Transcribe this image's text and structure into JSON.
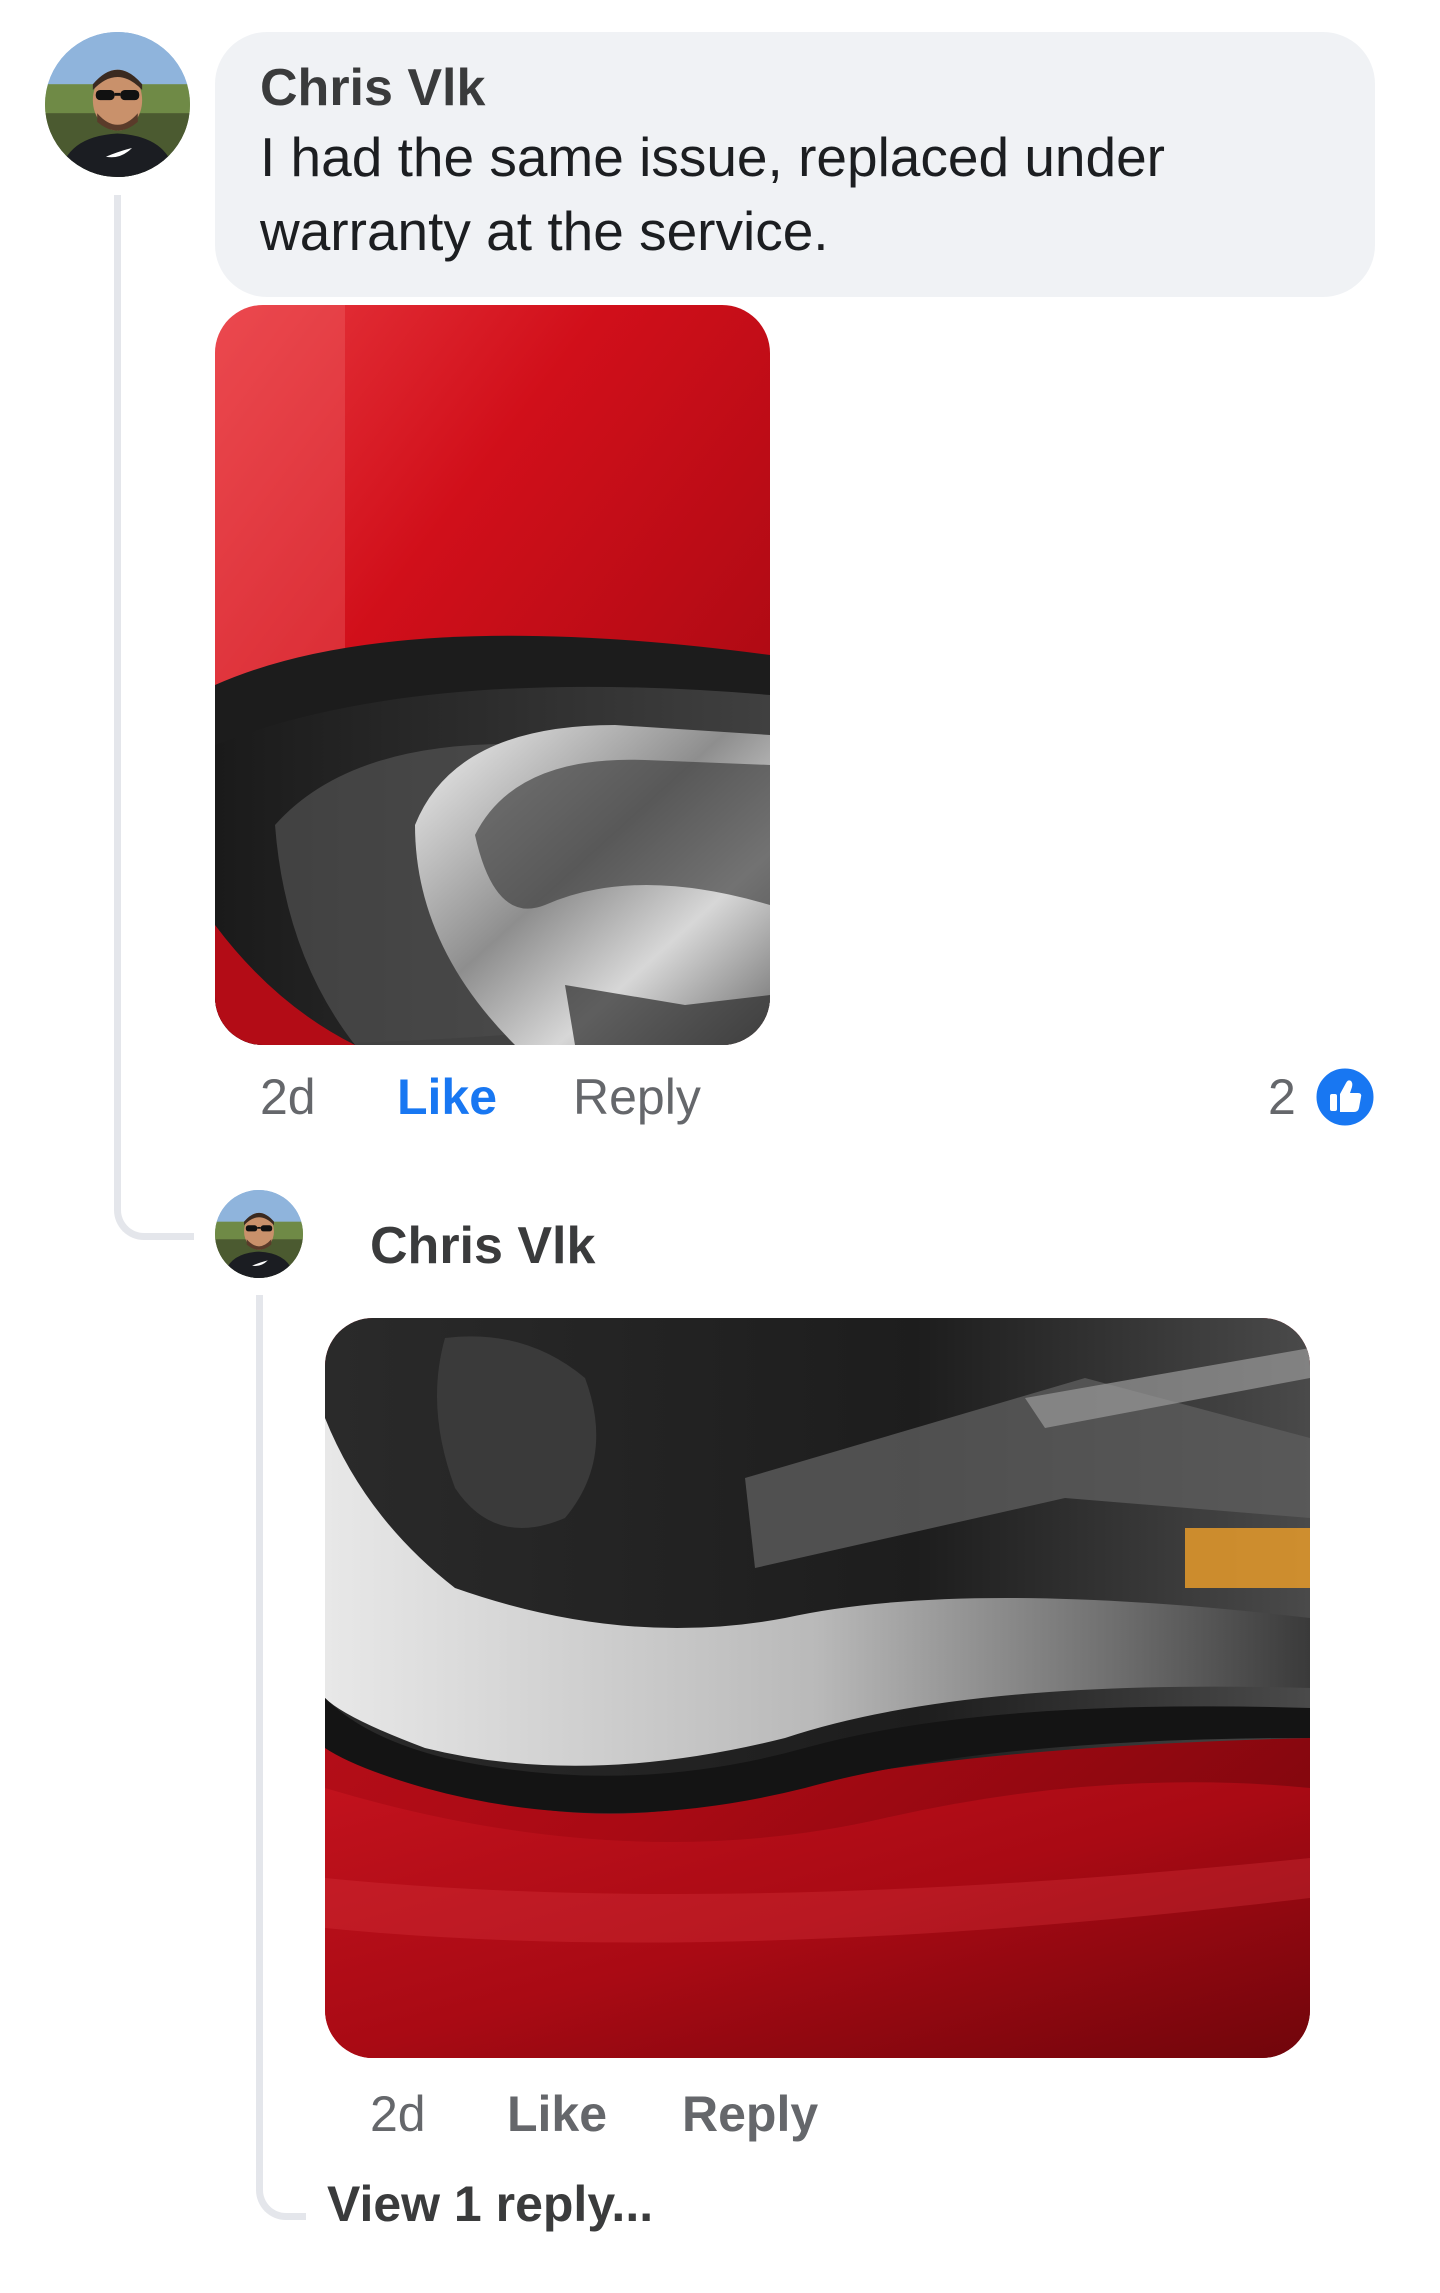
{
  "comment": {
    "author": "Chris Vlk",
    "text_line1": "I had the same issue, replaced under",
    "text_line2": "warranty at the service.",
    "time": "2d",
    "like_label": "Like",
    "reply_label": "Reply",
    "reaction_count": "2",
    "reaction_icon": "thumbs-up-icon",
    "reaction_color": "#1877f2"
  },
  "reply": {
    "author": "Chris Vlk",
    "time": "2d",
    "like_label": "Like",
    "reply_label": "Reply",
    "view_replies_label": "View 1 reply..."
  }
}
